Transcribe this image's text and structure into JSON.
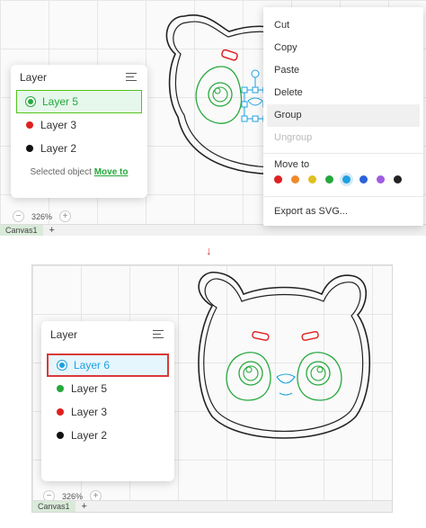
{
  "top": {
    "layer_panel": {
      "title": "Layer",
      "layers": [
        {
          "label": "Layer 5",
          "color": "#25a83c"
        },
        {
          "label": "Layer 3",
          "color": "#e02020"
        },
        {
          "label": "Layer 2",
          "color": "#111111"
        }
      ],
      "footer_prefix": "Selected object",
      "footer_link": "Move to"
    },
    "zoom": {
      "minus": "−",
      "value": "326%",
      "plus": "+"
    },
    "tabs": {
      "canvas": "Canvas1",
      "add": "+"
    },
    "context_menu": {
      "items": [
        "Cut",
        "Copy",
        "Paste",
        "Delete",
        "Group",
        "Ungroup"
      ],
      "move_to": "Move to",
      "swatches": [
        "#e02020",
        "#f08a2c",
        "#e0c020",
        "#25a83c",
        "#1da1e2",
        "#2b62d9",
        "#a05ce0",
        "#222222"
      ],
      "export": "Export as SVG..."
    }
  },
  "arrow": "↓",
  "bottom": {
    "layer_panel": {
      "title": "Layer",
      "layers": [
        {
          "label": "Layer 6",
          "color": "#1da1e2"
        },
        {
          "label": "Layer 5",
          "color": "#25a83c"
        },
        {
          "label": "Layer 3",
          "color": "#e02020"
        },
        {
          "label": "Layer 2",
          "color": "#111111"
        }
      ]
    },
    "zoom": {
      "minus": "−",
      "value": "326%",
      "plus": "+"
    },
    "tabs": {
      "canvas": "Canvas1",
      "add": "+"
    }
  },
  "colors": {
    "accent_green": "#25a83c",
    "accent_blue": "#1da1e2",
    "highlight_red": "#d93a3a"
  }
}
